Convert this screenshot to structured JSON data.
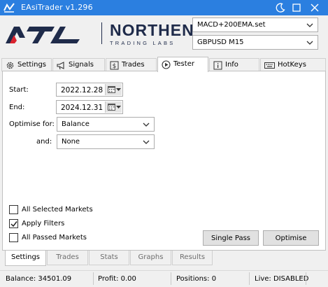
{
  "window": {
    "title": "EAsiTrader v1.296",
    "accent_color": "#2b7fe0"
  },
  "brand": {
    "logo_text": "NTL",
    "name": "NORTHEN",
    "subtitle": "TRADING LABS",
    "color": "#1f2b4a"
  },
  "selectors": {
    "strategy": "MACD+200EMA.set",
    "market": "GBPUSD M15"
  },
  "tabs": [
    {
      "label": "Settings",
      "icon": "gear-icon"
    },
    {
      "label": "Signals",
      "icon": "megaphone-icon"
    },
    {
      "label": "Trades",
      "icon": "dollar-icon"
    },
    {
      "label": "Tester",
      "icon": "play-icon",
      "active": true
    },
    {
      "label": "Info",
      "icon": "info-icon"
    },
    {
      "label": "HotKeys",
      "icon": "keyboard-icon"
    }
  ],
  "tester": {
    "start_label": "Start:",
    "start_date": "2022.12.28",
    "end_label": "End:",
    "end_date": "2024.12.31",
    "optimise_label": "Optimise for:",
    "optimise_value": "Balance",
    "and_label": "and:",
    "and_value": "None",
    "checkboxes": [
      {
        "label": "All Selected Markets",
        "checked": false
      },
      {
        "label": "Apply Filters",
        "checked": true
      },
      {
        "label": "All Passed Markets",
        "checked": false
      }
    ],
    "single_pass_label": "Single Pass",
    "optimise_button_label": "Optimise"
  },
  "subtabs": [
    {
      "label": "Settings",
      "active": true
    },
    {
      "label": "Trades"
    },
    {
      "label": "Stats"
    },
    {
      "label": "Graphs"
    },
    {
      "label": "Results"
    }
  ],
  "status": {
    "balance": "Balance: 34501.09",
    "profit": "Profit: 0.00",
    "positions": "Positions: 0",
    "live": "Live: DISABLED"
  }
}
